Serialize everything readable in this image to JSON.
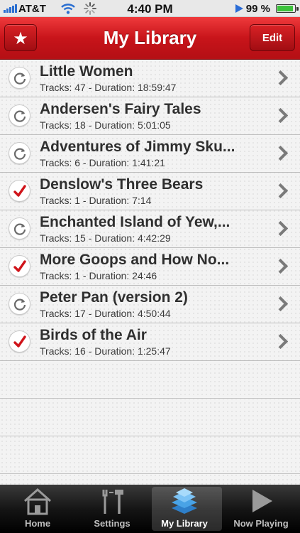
{
  "status_bar": {
    "carrier": "AT&T",
    "time": "4:40 PM",
    "battery_percent": "99 %",
    "battery_level": 0.99
  },
  "nav": {
    "title": "My Library",
    "edit_label": "Edit",
    "star_icon": "star-icon"
  },
  "books": [
    {
      "title": "Little Women",
      "meta": "Tracks: 47 - Duration: 18:59:47",
      "status": "sync"
    },
    {
      "title": "Andersen's Fairy Tales",
      "meta": "Tracks: 18 - Duration: 5:01:05",
      "status": "sync"
    },
    {
      "title": "Adventures of Jimmy Sku...",
      "meta": "Tracks: 6 - Duration: 1:41:21",
      "status": "sync"
    },
    {
      "title": "Denslow's Three Bears",
      "meta": "Tracks: 1 - Duration: 7:14",
      "status": "done"
    },
    {
      "title": "Enchanted Island of Yew,...",
      "meta": "Tracks: 15 - Duration: 4:42:29",
      "status": "sync"
    },
    {
      "title": "More Goops and How No...",
      "meta": "Tracks: 1 - Duration: 24:46",
      "status": "done"
    },
    {
      "title": "Peter Pan (version 2)",
      "meta": "Tracks: 17 - Duration: 4:50:44",
      "status": "sync"
    },
    {
      "title": "Birds of the Air",
      "meta": "Tracks: 16 - Duration: 1:25:47",
      "status": "done"
    }
  ],
  "tabs": [
    {
      "label": "Home",
      "icon": "home-icon"
    },
    {
      "label": "Settings",
      "icon": "tools-icon"
    },
    {
      "label": "My Library",
      "icon": "books-icon",
      "active": true
    },
    {
      "label": "Now Playing",
      "icon": "play-icon"
    }
  ],
  "colors": {
    "navbar": "#c8141a",
    "check": "#d0141a",
    "sync": "#6b6b6b"
  }
}
